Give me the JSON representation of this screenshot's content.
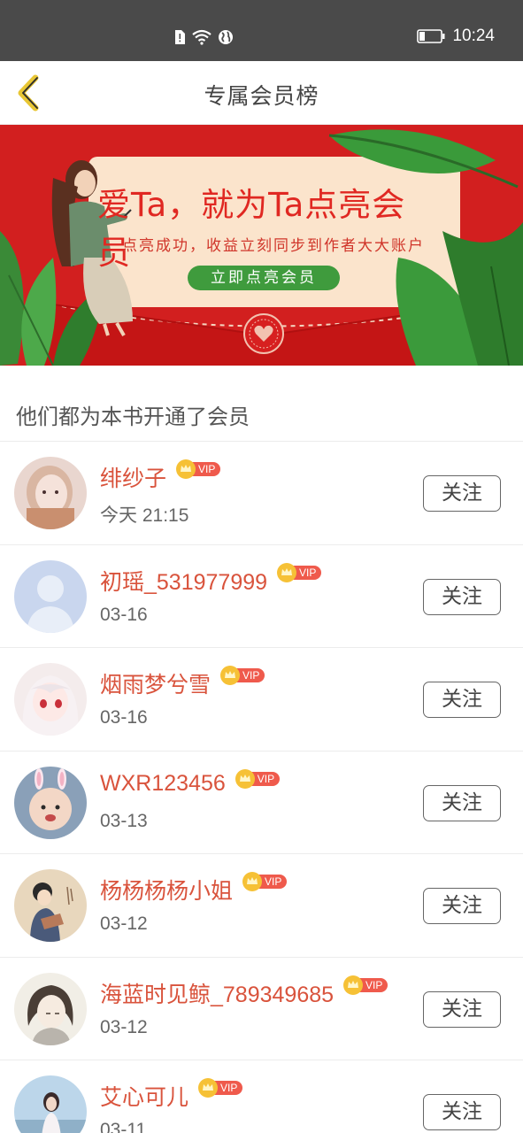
{
  "status_bar": {
    "time": "10:24",
    "icons": [
      "sim-alert-icon",
      "wifi-icon",
      "globe-icon",
      "battery-icon"
    ]
  },
  "nav": {
    "title": "专属会员榜",
    "back_icon": "chevron-left-icon"
  },
  "banner": {
    "headline": "爱Ta，就为Ta点亮会员",
    "subtitle": "点亮成功，收益立刻同步到作者大大账户",
    "cta": "立即点亮会员"
  },
  "section": {
    "title": "他们都为本书开通了会员"
  },
  "members": [
    {
      "name": "绯纱子",
      "time": "今天 21:15",
      "vip": "VIP",
      "follow": "关注",
      "avatar": "avatar-photo-girl"
    },
    {
      "name": "初瑶_531977999",
      "time": "03-16",
      "vip": "VIP",
      "follow": "关注",
      "avatar": "avatar-default"
    },
    {
      "name": "烟雨梦兮雪",
      "time": "03-16",
      "vip": "VIP",
      "follow": "关注",
      "avatar": "avatar-anime-girl"
    },
    {
      "name": "WXR123456",
      "time": "03-13",
      "vip": "VIP",
      "follow": "关注",
      "avatar": "avatar-baby"
    },
    {
      "name": "杨杨杨杨小姐",
      "time": "03-12",
      "vip": "VIP",
      "follow": "关注",
      "avatar": "avatar-illustration"
    },
    {
      "name": "海蓝时见鲸_789349685",
      "time": "03-12",
      "vip": "VIP",
      "follow": "关注",
      "avatar": "avatar-sketch-girl"
    },
    {
      "name": "艾心可儿",
      "time": "03-11",
      "vip": "VIP",
      "follow": "关注",
      "avatar": "avatar-photo-outdoor"
    }
  ],
  "colors": {
    "accent_name": "#d9533c",
    "vip_badge": "#ef5a4c",
    "banner_red": "#d21f1f",
    "banner_green": "#3f9b3d",
    "status_bar": "#4a4a4a"
  }
}
